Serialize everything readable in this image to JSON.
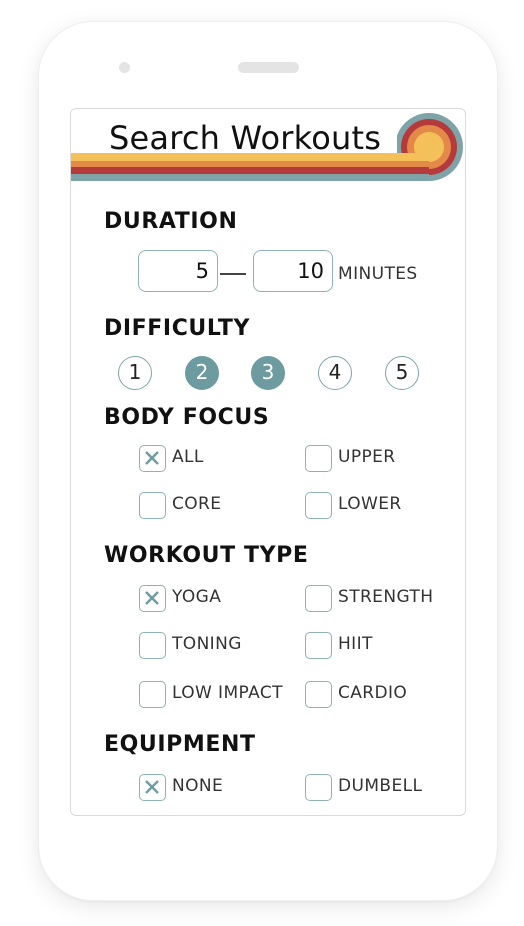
{
  "title": "Search Workouts",
  "colors": {
    "accent": "#6e9ba0",
    "border": "#8fb2b6",
    "stripe_yellow": "#f4c05a",
    "stripe_orange": "#e48a48",
    "stripe_red": "#b53a3c",
    "stripe_teal": "#7fa4a8"
  },
  "duration": {
    "heading": "DURATION",
    "min_value": "5",
    "max_value": "10",
    "unit": "MINUTES"
  },
  "difficulty": {
    "heading": "DIFFICULTY",
    "levels": [
      "1",
      "2",
      "3",
      "4",
      "5"
    ],
    "selected": [
      "2",
      "3"
    ]
  },
  "body_focus": {
    "heading": "BODY FOCUS",
    "options": [
      {
        "label": "ALL",
        "checked": true
      },
      {
        "label": "UPPER",
        "checked": false
      },
      {
        "label": "CORE",
        "checked": false
      },
      {
        "label": "LOWER",
        "checked": false
      }
    ]
  },
  "workout_type": {
    "heading": "WORKOUT TYPE",
    "options": [
      {
        "label": "YOGA",
        "checked": true
      },
      {
        "label": "STRENGTH",
        "checked": false
      },
      {
        "label": "TONING",
        "checked": false
      },
      {
        "label": "HIIT",
        "checked": false
      },
      {
        "label": "LOW IMPACT",
        "checked": false
      },
      {
        "label": "CARDIO",
        "checked": false
      }
    ]
  },
  "equipment": {
    "heading": "EQUIPMENT",
    "options": [
      {
        "label": "NONE",
        "checked": true
      },
      {
        "label": "DUMBELL",
        "checked": false
      }
    ]
  }
}
